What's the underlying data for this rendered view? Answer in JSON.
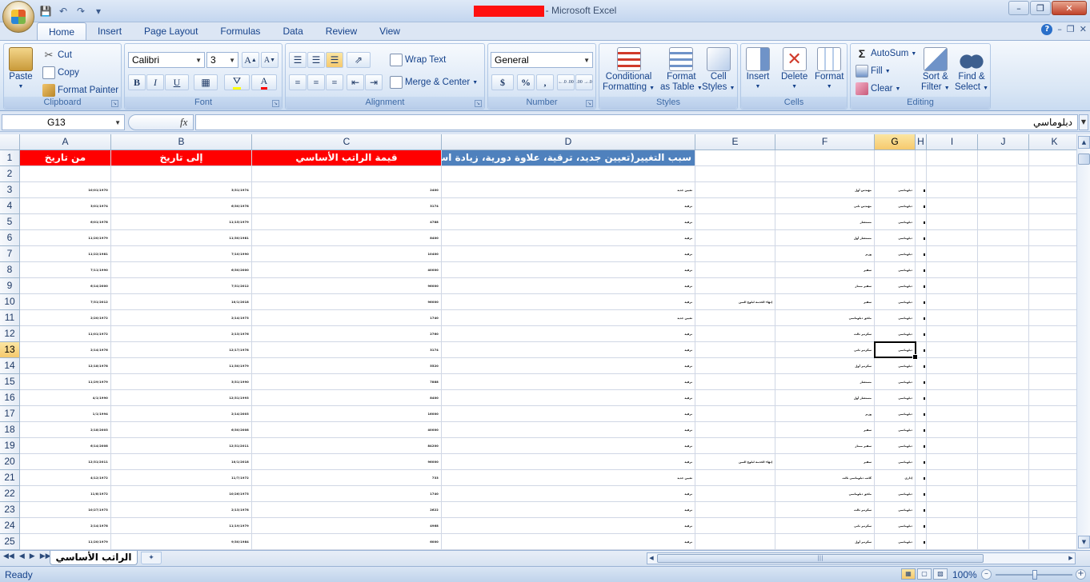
{
  "window": {
    "title_suffix": "- Microsoft Excel"
  },
  "tabs": [
    "Home",
    "Insert",
    "Page Layout",
    "Formulas",
    "Data",
    "Review",
    "View"
  ],
  "ribbon": {
    "clipboard": {
      "label": "Clipboard",
      "paste": "Paste",
      "cut": "Cut",
      "copy": "Copy",
      "format_painter": "Format Painter"
    },
    "font": {
      "label": "Font",
      "name": "Calibri",
      "size": "3",
      "bold": "B",
      "italic": "I",
      "underline": "U",
      "grow": "A",
      "shrink": "A",
      "font_color": "A"
    },
    "alignment": {
      "label": "Alignment",
      "wrap_text": "Wrap Text",
      "merge_center": "Merge & Center"
    },
    "number": {
      "label": "Number",
      "format": "General",
      "currency": "$",
      "percent": "%",
      "comma": ",",
      "inc_dec": "←.0 .00",
      "dec_dec": ".00 →.0"
    },
    "styles": {
      "label": "Styles",
      "conditional": [
        "Conditional",
        "Formatting"
      ],
      "format_table": [
        "Format",
        "as Table"
      ],
      "cell_styles": [
        "Cell",
        "Styles"
      ]
    },
    "cells": {
      "label": "Cells",
      "insert": "Insert",
      "delete": "Delete",
      "format": "Format"
    },
    "editing": {
      "label": "Editing",
      "autosum": "AutoSum",
      "fill": "Fill",
      "clear": "Clear",
      "sort_filter": [
        "Sort &",
        "Filter"
      ],
      "find_select": [
        "Find &",
        "Select"
      ]
    }
  },
  "formula_bar": {
    "name_box": "G13",
    "fx": "fx",
    "value": "دبلوماسي"
  },
  "columns": [
    "A",
    "B",
    "C",
    "D",
    "E",
    "F",
    "G",
    "H",
    "I",
    "J",
    "K"
  ],
  "selected_column": "G",
  "rows": [
    "1",
    "2",
    "3",
    "4",
    "5",
    "6",
    "7",
    "8",
    "9",
    "10",
    "11",
    "12",
    "13",
    "14",
    "15",
    "16",
    "17",
    "18",
    "19",
    "20",
    "21",
    "22",
    "23",
    "24",
    "25"
  ],
  "selected_row": "13",
  "header_row": {
    "A": "من تاريخ",
    "B": "إلى تاريخ",
    "C": "قيمة الراتب الأساسي",
    "D": "سبب التغيير(تعيين جديد، ترقية، علاوة دورية، زيادة استثنائية)"
  },
  "data_rows": [
    {
      "A": "10/01/1970",
      "B": "3/31/1974",
      "C": "2400",
      "D": "تعيين جديد",
      "E": "",
      "F": "مهندس أول",
      "G": "دبلوماسي"
    },
    {
      "A": "3/01/1974",
      "B": "6/30/1978",
      "C": "3174",
      "D": "ترقية",
      "E": "",
      "F": "مهندس ثاني",
      "G": "دبلوماسي"
    },
    {
      "A": "6/01/1978",
      "B": "11/15/1979",
      "C": "4788",
      "D": "ترقية",
      "E": "",
      "F": "مستشار",
      "G": "دبلوماسي"
    },
    {
      "A": "11/20/1979",
      "B": "11/30/1981",
      "C": "8400",
      "D": "ترقية",
      "E": "",
      "F": "مستشار أول",
      "G": "دبلوماسي"
    },
    {
      "A": "11/22/1981",
      "B": "7/10/1990",
      "C": "10400",
      "D": "ترقية",
      "E": "",
      "F": "وزير",
      "G": "دبلوماسي"
    },
    {
      "A": "7/11/1990",
      "B": "6/30/2000",
      "C": "40000",
      "D": "ترقية",
      "E": "",
      "F": "سفير",
      "G": "دبلوماسي"
    },
    {
      "A": "6/14/2000",
      "B": "7/31/2012",
      "C": "96000",
      "D": "ترقية",
      "E": "",
      "F": "سفير ممتاز",
      "G": "دبلوماسي"
    },
    {
      "A": "7/31/2012",
      "B": "10/1/2018",
      "C": "96000",
      "D": "ترقية",
      "E": "إنهاء الخدمة لبلوغ السن",
      "F": "سفير",
      "G": "دبلوماسي"
    },
    {
      "A": "2/20/1972",
      "B": "2/14/1973",
      "C": "1740",
      "D": "تعيين جديد",
      "E": "",
      "F": "ملحق دبلوماسي",
      "G": "دبلوماسي"
    },
    {
      "A": "11/01/1972",
      "B": "2/13/1976",
      "C": "2760",
      "D": "ترقية",
      "E": "",
      "F": "سكرتير ثالث",
      "G": "دبلوماسي"
    },
    {
      "A": "2/14/1976",
      "B": "12/17/1978",
      "C": "3174",
      "D": "ترقية",
      "E": "",
      "F": "سكرتير ثاني",
      "G": "دبلوماسي"
    },
    {
      "A": "12/18/1978",
      "B": "11/30/1979",
      "C": "5520",
      "D": "ترقية",
      "E": "",
      "F": "سكرتير أول",
      "G": "دبلوماسي"
    },
    {
      "A": "11/29/1979",
      "B": "3/31/1990",
      "C": "7888",
      "D": "ترقية",
      "E": "",
      "F": "مستشار",
      "G": "دبلوماسي"
    },
    {
      "A": "4/1/1990",
      "B": "12/31/1993",
      "C": "8400",
      "D": "ترقية",
      "E": "",
      "F": "مستشار أول",
      "G": "دبلوماسي"
    },
    {
      "A": "1/1/1994",
      "B": "2/14/2003",
      "C": "16000",
      "D": "ترقية",
      "E": "",
      "F": "وزير",
      "G": "دبلوماسي"
    },
    {
      "A": "2/18/2003",
      "B": "6/30/2008",
      "C": "40000",
      "D": "ترقية",
      "E": "",
      "F": "سفير",
      "G": "دبلوماسي"
    },
    {
      "A": "6/14/2008",
      "B": "12/31/2011",
      "C": "84200",
      "D": "ترقية",
      "E": "",
      "F": "سفير ممتاز",
      "G": "دبلوماسي"
    },
    {
      "A": "12/31/2011",
      "B": "10/1/2018",
      "C": "96000",
      "D": "ترقية",
      "E": "إنهاء الخدمة لبلوغ السن",
      "F": "سفير",
      "G": "دبلوماسي"
    },
    {
      "A": "4/12/1972",
      "B": "11/7/1972",
      "C": "733",
      "D": "تعيين جديد",
      "E": "",
      "F": "كاتب دبلوماسي ثالث",
      "G": "إداري"
    },
    {
      "A": "11/8/1972",
      "B": "10/26/1973",
      "C": "1740",
      "D": "ترقية",
      "E": "",
      "F": "ملحق دبلوماسي",
      "G": "دبلوماسي"
    },
    {
      "A": "10/27/1973",
      "B": "2/13/1978",
      "C": "2622",
      "D": "ترقية",
      "E": "",
      "F": "سكرتير ثالث",
      "G": "دبلوماسي"
    },
    {
      "A": "2/14/1978",
      "B": "11/19/1979",
      "C": "4968",
      "D": "ترقية",
      "E": "",
      "F": "سكرتير ثاني",
      "G": "دبلوماسي"
    },
    {
      "A": "11/20/1979",
      "B": "9/30/1984",
      "C": "6000",
      "D": "ترقية",
      "E": "",
      "F": "سكرتير أول",
      "G": "دبلوماسي"
    }
  ],
  "sheet": {
    "name": "الراتب الأساسي"
  },
  "status": {
    "text": "Ready",
    "zoom": "100%"
  }
}
